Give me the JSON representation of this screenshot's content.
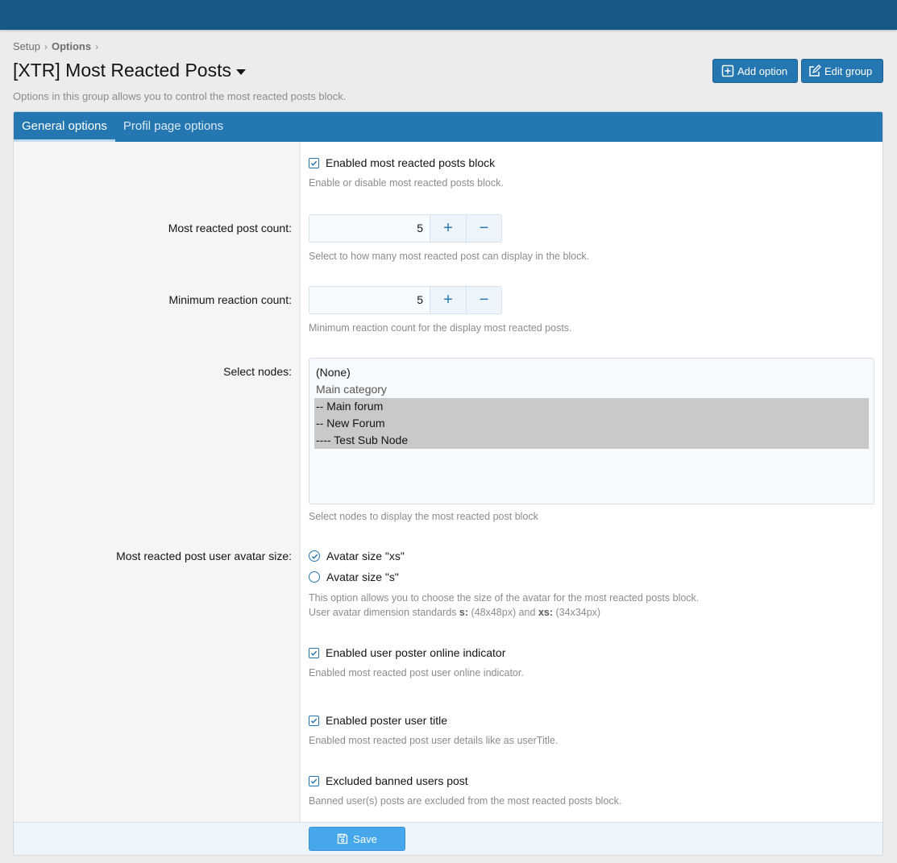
{
  "breadcrumb": {
    "item1": "Setup",
    "item2": "Options"
  },
  "page": {
    "title": "[XTR] Most Reacted Posts",
    "description": "Options in this group allows you to control the most reacted posts block."
  },
  "header_buttons": {
    "add_option": "Add option",
    "edit_group": "Edit group"
  },
  "tabs": [
    {
      "label": "General options",
      "active": true
    },
    {
      "label": "Profil page options",
      "active": false
    }
  ],
  "options": {
    "enabled_block": {
      "label": "Enabled most reacted posts block",
      "hint": "Enable or disable most reacted posts block.",
      "checked": true
    },
    "post_count": {
      "label": "Most reacted post count:",
      "value": "5",
      "hint": "Select to how many most reacted post can display in the block."
    },
    "min_reaction": {
      "label": "Minimum reaction count:",
      "value": "5",
      "hint": "Minimum reaction count for the display most reacted posts."
    },
    "select_nodes": {
      "label": "Select nodes:",
      "options": [
        {
          "text": "(None)",
          "selected": false
        },
        {
          "text": "Main category",
          "selected": false
        },
        {
          "text": "-- Main forum",
          "selected": true
        },
        {
          "text": "-- New Forum",
          "selected": true
        },
        {
          "text": "---- Test Sub Node",
          "selected": true
        }
      ],
      "hint": "Select nodes to display the most reacted post block"
    },
    "avatar_size": {
      "label": "Most reacted post user avatar size:",
      "choice_xs": "Avatar size \"xs\"",
      "choice_s": "Avatar size \"s\"",
      "selected": "xs",
      "hint_line1": "This option allows you to choose the size of the avatar for the most reacted posts block.",
      "hint_line2_prefix": "User avatar dimension standards",
      "hint_s": "s:",
      "hint_s_val": "(48x48px) and",
      "hint_xs": "xs:",
      "hint_xs_val": "(34x34px)"
    },
    "online_indicator": {
      "label": "Enabled user poster online indicator",
      "hint": "Enabled most reacted post user online indicator.",
      "checked": true
    },
    "user_title": {
      "label": "Enabled poster user title",
      "hint": "Enabled most reacted post user details like as userTitle.",
      "checked": true
    },
    "excluded_banned": {
      "label": "Excluded banned users post",
      "hint": "Banned user(s) posts are excluded from the most reacted posts block.",
      "checked": true
    }
  },
  "footer": {
    "save_label": "Save"
  },
  "colors": {
    "topbar": "#185886",
    "accent": "#2577b1",
    "save": "#47a7eb"
  },
  "stepper_icons": {
    "plus": "plus-icon",
    "minus": "minus-icon"
  }
}
